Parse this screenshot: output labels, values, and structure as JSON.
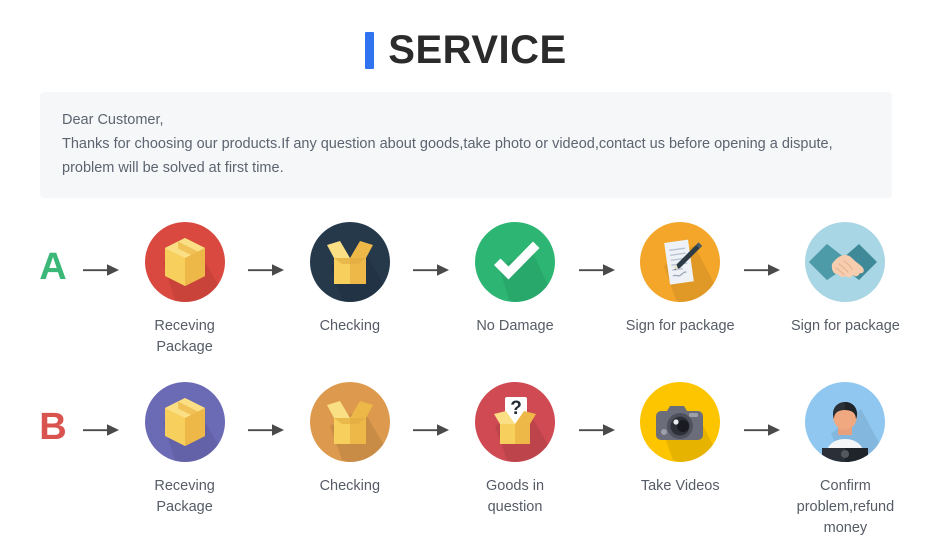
{
  "header": {
    "accent_color": "#2f73f0",
    "title": "SERVICE"
  },
  "notice": {
    "line1": "Dear Customer,",
    "line2": "Thanks for choosing our products.If any question about goods,take photo or videod,contact us before opening a dispute,",
    "line3": "problem will be solved at first time."
  },
  "flows": [
    {
      "letter": "A",
      "letter_color": "#3bb878",
      "steps": [
        {
          "icon": "closed-box-icon",
          "circle_color": "#d9493f",
          "label": "Receving Package"
        },
        {
          "icon": "open-box-icon",
          "circle_color": "#25394b",
          "label": "Checking"
        },
        {
          "icon": "checkmark-icon",
          "circle_color": "#2cb573",
          "label": "No Damage"
        },
        {
          "icon": "sign-document-icon",
          "circle_color": "#f4a62a",
          "label": "Sign for package"
        },
        {
          "icon": "handshake-icon",
          "circle_color": "#a9d6e5",
          "label": "Sign for package"
        }
      ]
    },
    {
      "letter": "B",
      "letter_color": "#d9534f",
      "steps": [
        {
          "icon": "closed-box-icon",
          "circle_color": "#6b6ab5",
          "label": "Receving Package"
        },
        {
          "icon": "open-box-icon",
          "circle_color": "#dd9a4e",
          "label": "Checking"
        },
        {
          "icon": "question-box-icon",
          "circle_color": "#cf4a52",
          "label": "Goods in question"
        },
        {
          "icon": "camera-icon",
          "circle_color": "#fdc500",
          "label": "Take Videos"
        },
        {
          "icon": "person-icon",
          "circle_color": "#8fc7f0",
          "label": "Confirm problem,refund money"
        }
      ]
    }
  ],
  "arrow": {
    "name": "arrow-right-icon",
    "color": "#4a4a4a"
  }
}
